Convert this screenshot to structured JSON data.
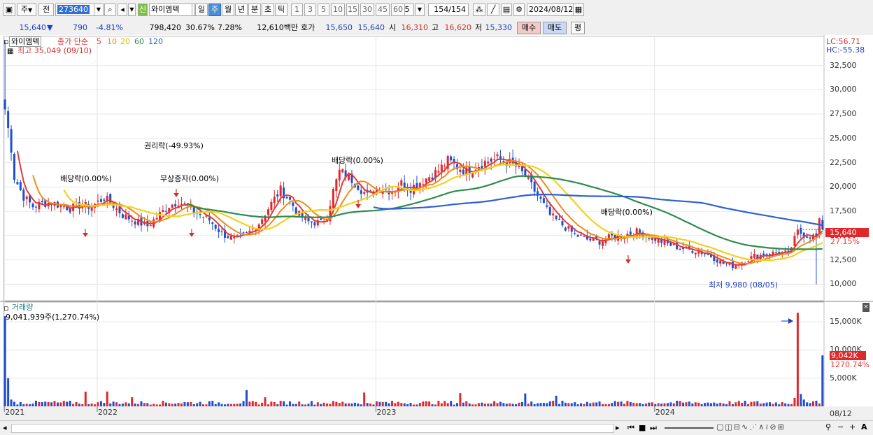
{
  "toolbar": {
    "period_select": "주",
    "prev_label": "전",
    "stock_code": "273640",
    "sin_label": "신",
    "stock_name": "와이엠텍",
    "period_tabs": [
      "일",
      "주",
      "월",
      "년",
      "분",
      "초",
      "틱"
    ],
    "active_period": "주",
    "interval_buttons": [
      "1",
      "3",
      "5",
      "10",
      "15",
      "30",
      "45",
      "60"
    ],
    "custom_interval": "5",
    "bar_count": "154/154",
    "date": "2024/08/12"
  },
  "quote": {
    "price": "15,640",
    "change_arrow": "▼",
    "change": "790",
    "change_pct": "-4.81%",
    "volume": "798,420",
    "volume_pct": "30.67%",
    "turnover": "7.28%",
    "amount": "12,610백만",
    "hoga_label": "호가",
    "ask": "15,650",
    "bid": "15,640",
    "open_label": "시",
    "open": "16,310",
    "high_label": "고",
    "high": "16,620",
    "low_label": "저",
    "low": "15,330",
    "buy_button": "매수",
    "sell_button": "매도",
    "eval_button": "평"
  },
  "chart": {
    "legend_name": "와이엠텍",
    "legend_type": "종가 단순",
    "ma_periods": [
      "5",
      "10",
      "20",
      "60",
      "120"
    ],
    "ma_colors": [
      "#e53935",
      "#ef8c1b",
      "#f2d21c",
      "#2e8b4f",
      "#2f5fd6"
    ],
    "max_label": "최고 35,049 (09/10)",
    "min_label": "최저 9,980 (08/05)",
    "lc_label": "LC:56.71",
    "hc_label": "HC:-55.38",
    "price_tag": "15,640",
    "price_pct": "27.15%",
    "events": [
      {
        "label": "배당락(0.00%)"
      },
      {
        "label": "권리락(-49.93%)"
      },
      {
        "label": "무상증자(0.00%)"
      },
      {
        "label": "배당락(0.00%)"
      },
      {
        "label": "배당락(0.00%)"
      }
    ],
    "volume_title": "거래량",
    "volume_info": "9,041,939주(1,270.74%)",
    "volume_tag": "9,042K",
    "volume_pct": "1270.74%",
    "last_date_label": "08/12"
  },
  "chart_data": {
    "type": "candlestick",
    "price_axis_ticks": [
      32500,
      30000,
      27500,
      25000,
      22500,
      20000,
      17500,
      15000,
      12500,
      10000
    ],
    "price_axis_labels": [
      "32,500",
      "30,000",
      "27,500",
      "25,000",
      "22,500",
      "20,000",
      "17,500",
      "15,000",
      "12,500",
      "10,000"
    ],
    "volume_axis_labels": [
      "15,000K",
      "10,000K",
      "5,000K"
    ],
    "volume_axis_ticks": [
      15000,
      10000,
      5000
    ],
    "x_axis_labels": [
      "2021",
      "2022",
      "2023",
      "2024"
    ],
    "x_label_week_index": [
      0,
      30,
      120,
      210
    ],
    "anchors": [
      [
        0,
        28000
      ],
      [
        2,
        24000
      ],
      [
        3,
        21000
      ],
      [
        6,
        19000
      ],
      [
        9,
        18000
      ],
      [
        12,
        18300
      ],
      [
        15,
        18400
      ],
      [
        18,
        18100
      ],
      [
        21,
        17800
      ],
      [
        24,
        18100
      ],
      [
        28,
        18000
      ],
      [
        32,
        18900
      ],
      [
        35,
        18100
      ],
      [
        38,
        17100
      ],
      [
        42,
        16500
      ],
      [
        46,
        16000
      ],
      [
        50,
        17200
      ],
      [
        53,
        18100
      ],
      [
        56,
        18500
      ],
      [
        59,
        18000
      ],
      [
        62,
        17300
      ],
      [
        66,
        16600
      ],
      [
        70,
        15200
      ],
      [
        74,
        14600
      ],
      [
        78,
        15100
      ],
      [
        82,
        16300
      ],
      [
        86,
        18300
      ],
      [
        89,
        19700
      ],
      [
        92,
        18600
      ],
      [
        95,
        17100
      ],
      [
        98,
        16400
      ],
      [
        102,
        16300
      ],
      [
        104,
        17100
      ],
      [
        106,
        19600
      ],
      [
        108,
        21600
      ],
      [
        111,
        21100
      ],
      [
        114,
        20100
      ],
      [
        117,
        19100
      ],
      [
        121,
        19900
      ],
      [
        125,
        19600
      ],
      [
        128,
        20400
      ],
      [
        131,
        19900
      ],
      [
        134,
        20500
      ],
      [
        137,
        21100
      ],
      [
        140,
        21700
      ],
      [
        143,
        22700
      ],
      [
        146,
        22100
      ],
      [
        149,
        21600
      ],
      [
        152,
        22100
      ],
      [
        155,
        22600
      ],
      [
        159,
        22900
      ],
      [
        162,
        22600
      ],
      [
        165,
        22100
      ],
      [
        168,
        21100
      ],
      [
        172,
        19100
      ],
      [
        176,
        17100
      ],
      [
        180,
        16100
      ],
      [
        184,
        15100
      ],
      [
        188,
        14600
      ],
      [
        192,
        14400
      ],
      [
        196,
        14900
      ],
      [
        200,
        15100
      ],
      [
        204,
        15400
      ],
      [
        208,
        14900
      ],
      [
        212,
        14400
      ],
      [
        216,
        13900
      ],
      [
        220,
        13600
      ],
      [
        224,
        13400
      ],
      [
        228,
        12900
      ],
      [
        232,
        12100
      ],
      [
        235,
        11900
      ],
      [
        238,
        12300
      ],
      [
        242,
        12900
      ],
      [
        246,
        13100
      ],
      [
        250,
        13300
      ],
      [
        253,
        13100
      ],
      [
        256,
        15400
      ],
      [
        259,
        15000
      ],
      [
        262,
        14900
      ],
      [
        263,
        16400
      ],
      [
        264,
        15640
      ]
    ],
    "max": {
      "week_index": 0,
      "value": 35049
    },
    "min": {
      "week_index": 262,
      "value": 9980
    },
    "last_close": 15640,
    "last_volume_k": 9042,
    "spike_volumes_k": [
      {
        "week_index": 0,
        "value": 16000
      },
      {
        "week_index": 256,
        "value": 16600
      }
    ]
  }
}
